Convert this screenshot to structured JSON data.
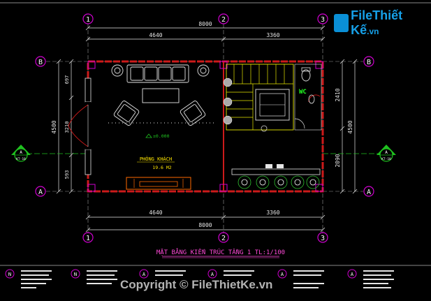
{
  "colors": {
    "background": "#000000",
    "wall": "#cc1a1a",
    "grid_line": "#9a9a9a",
    "dimension": "#e6e6e6",
    "axis_bubble": "#d000d0",
    "section_marker": "#1fc01f",
    "furniture": "#e6e6e6",
    "stair": "#e6e600",
    "title": "#ff4ad8",
    "counter": "#ff6a00",
    "plants": "#30c030",
    "wc_text": "#22ff22",
    "logo": "#16a0e8"
  },
  "grid_axes_top": [
    "1",
    "2",
    "3"
  ],
  "grid_axes_bottom": [
    "1",
    "2",
    "3"
  ],
  "grid_axes_left": [
    "B",
    "A"
  ],
  "grid_axes_right": [
    "B",
    "A"
  ],
  "dimensions": {
    "top_total": "8000",
    "top_left": "4640",
    "top_right": "3360",
    "bottom_total": "8000",
    "bottom_left": "4640",
    "bottom_right": "3360",
    "left_total": "4500",
    "left_top": "697",
    "left_mid": "3210",
    "left_bot": "593",
    "right_total": "4500",
    "right_top": "2410",
    "right_bot": "2090"
  },
  "section_marker": {
    "letter": "A",
    "sheet": "KT-10"
  },
  "room": {
    "name": "PHÒNG KHÁCH",
    "area": "19.6 M2",
    "level": "±0.000"
  },
  "wc_label": "WC",
  "drawing_title": "MẶT BẰNG KIẾN TRÚC TẦNG 1 TL:1/100",
  "watermark": {
    "logo_main": "File",
    "logo_accent": "Thiết Kế",
    "logo_suffix": ".vn",
    "copyright": "Copyright © FileThietKe.vn"
  },
  "legend_symbols": [
    "N",
    "N",
    "A",
    "A",
    "A",
    "A"
  ]
}
